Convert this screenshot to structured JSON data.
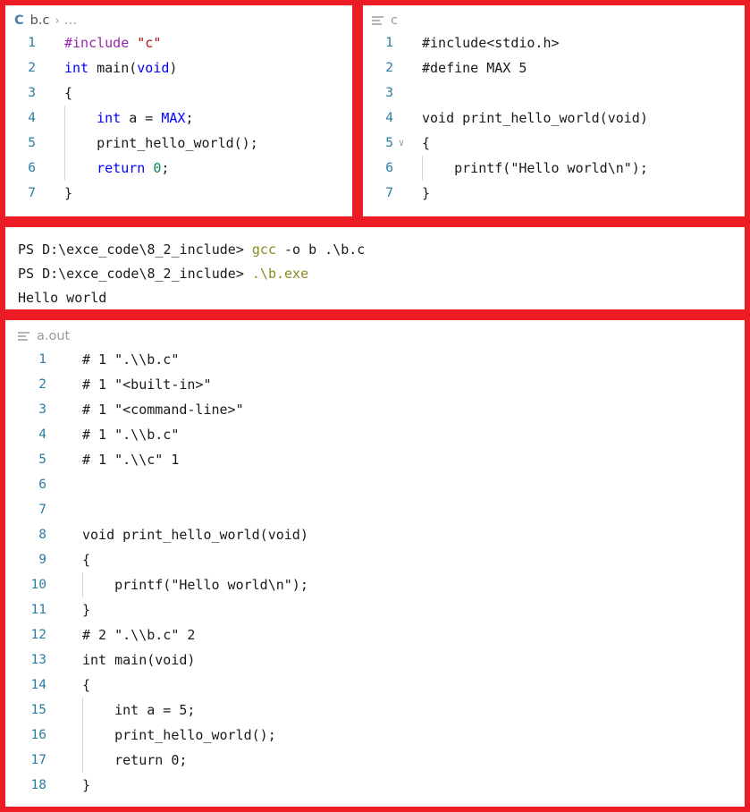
{
  "colors": {
    "annotation_border": "#ed1c24",
    "line_number": "#2c7ba0",
    "keyword": "#0000ff",
    "preprocessor": "#9b24b0",
    "string": "#a31515",
    "number": "#098658",
    "terminal_command": "#8a8a20",
    "background": "#ffffff"
  },
  "editor_bc": {
    "lang_icon": "c-file-icon",
    "lang_letter": "C",
    "file": "b.c",
    "separator": "›",
    "dots": "…"
  },
  "editor_bc_right": {
    "outline_icon": "outline-lines-icon",
    "label": "c"
  },
  "aout_bc": {
    "outline_icon": "outline-lines-icon",
    "label": "a.out"
  },
  "panel_bc": {
    "lines": [
      {
        "n": "1",
        "fold": "",
        "indent": false,
        "tokens": [
          {
            "t": "#include",
            "c": "pre"
          },
          {
            "t": " ",
            "c": "plain"
          },
          {
            "t": "\"c\"",
            "c": "str"
          }
        ]
      },
      {
        "n": "2",
        "fold": "",
        "indent": false,
        "tokens": [
          {
            "t": "int",
            "c": "kw"
          },
          {
            "t": " main(",
            "c": "plain"
          },
          {
            "t": "void",
            "c": "kw"
          },
          {
            "t": ")",
            "c": "plain"
          }
        ]
      },
      {
        "n": "3",
        "fold": "",
        "indent": false,
        "tokens": [
          {
            "t": "{",
            "c": "plain"
          }
        ]
      },
      {
        "n": "4",
        "fold": "",
        "indent": true,
        "tokens": [
          {
            "t": "    ",
            "c": "plain"
          },
          {
            "t": "int",
            "c": "kw"
          },
          {
            "t": " a = ",
            "c": "plain"
          },
          {
            "t": "MAX",
            "c": "macro"
          },
          {
            "t": ";",
            "c": "plain"
          }
        ]
      },
      {
        "n": "5",
        "fold": "",
        "indent": true,
        "tokens": [
          {
            "t": "    print_hello_world();",
            "c": "plain"
          }
        ]
      },
      {
        "n": "6",
        "fold": "",
        "indent": true,
        "tokens": [
          {
            "t": "    ",
            "c": "plain"
          },
          {
            "t": "return",
            "c": "kw"
          },
          {
            "t": " ",
            "c": "plain"
          },
          {
            "t": "0",
            "c": "num"
          },
          {
            "t": ";",
            "c": "plain"
          }
        ]
      },
      {
        "n": "7",
        "fold": "",
        "indent": false,
        "tokens": [
          {
            "t": "}",
            "c": "plain"
          }
        ]
      }
    ]
  },
  "panel_c": {
    "lines": [
      {
        "n": "1",
        "fold": "",
        "indent": false,
        "tokens": [
          {
            "t": "#include<stdio.h>",
            "c": "plain"
          }
        ]
      },
      {
        "n": "2",
        "fold": "",
        "indent": false,
        "tokens": [
          {
            "t": "#define MAX 5",
            "c": "plain"
          }
        ]
      },
      {
        "n": "3",
        "fold": "",
        "indent": false,
        "tokens": [
          {
            "t": "",
            "c": "plain"
          }
        ]
      },
      {
        "n": "4",
        "fold": "",
        "indent": false,
        "tokens": [
          {
            "t": "void print_hello_world(void)",
            "c": "plain"
          }
        ]
      },
      {
        "n": "5",
        "fold": "∨",
        "indent": false,
        "tokens": [
          {
            "t": "{",
            "c": "plain"
          }
        ]
      },
      {
        "n": "6",
        "fold": "",
        "indent": true,
        "tokens": [
          {
            "t": "    printf(\"Hello world\\n\");",
            "c": "plain"
          }
        ]
      },
      {
        "n": "7",
        "fold": "",
        "indent": false,
        "tokens": [
          {
            "t": "}",
            "c": "plain"
          }
        ]
      }
    ]
  },
  "terminal": {
    "lines": [
      {
        "parts": [
          {
            "t": "PS D:\\exce_code\\8_2_include> ",
            "c": "plain"
          },
          {
            "t": "gcc",
            "c": "cmd"
          },
          {
            "t": " -o b .\\b.c",
            "c": "plain"
          }
        ]
      },
      {
        "parts": [
          {
            "t": "PS D:\\exce_code\\8_2_include> ",
            "c": "plain"
          },
          {
            "t": ".\\b.exe",
            "c": "cmd"
          }
        ]
      },
      {
        "parts": [
          {
            "t": "Hello world",
            "c": "plain"
          }
        ]
      }
    ]
  },
  "panel_aout": {
    "lines": [
      {
        "n": "1",
        "fold": "",
        "indent": false,
        "tokens": [
          {
            "t": "# 1 \".\\\\b.c\"",
            "c": "plain"
          }
        ]
      },
      {
        "n": "2",
        "fold": "",
        "indent": false,
        "tokens": [
          {
            "t": "# 1 \"<built-in>\"",
            "c": "plain"
          }
        ]
      },
      {
        "n": "3",
        "fold": "",
        "indent": false,
        "tokens": [
          {
            "t": "# 1 \"<command-line>\"",
            "c": "plain"
          }
        ]
      },
      {
        "n": "4",
        "fold": "",
        "indent": false,
        "tokens": [
          {
            "t": "# 1 \".\\\\b.c\"",
            "c": "plain"
          }
        ]
      },
      {
        "n": "5",
        "fold": "",
        "indent": false,
        "tokens": [
          {
            "t": "# 1 \".\\\\c\" 1",
            "c": "plain"
          }
        ]
      },
      {
        "n": "6",
        "fold": "",
        "indent": false,
        "tokens": [
          {
            "t": "",
            "c": "plain"
          }
        ]
      },
      {
        "n": "7",
        "fold": "",
        "indent": false,
        "tokens": [
          {
            "t": "",
            "c": "plain"
          }
        ]
      },
      {
        "n": "8",
        "fold": "",
        "indent": false,
        "tokens": [
          {
            "t": "void print_hello_world(void)",
            "c": "plain"
          }
        ]
      },
      {
        "n": "9",
        "fold": "",
        "indent": false,
        "tokens": [
          {
            "t": "{",
            "c": "plain"
          }
        ]
      },
      {
        "n": "10",
        "fold": "",
        "indent": true,
        "tokens": [
          {
            "t": "    printf(\"Hello world\\n\");",
            "c": "plain"
          }
        ]
      },
      {
        "n": "11",
        "fold": "",
        "indent": false,
        "tokens": [
          {
            "t": "}",
            "c": "plain"
          }
        ]
      },
      {
        "n": "12",
        "fold": "",
        "indent": false,
        "tokens": [
          {
            "t": "# 2 \".\\\\b.c\" 2",
            "c": "plain"
          }
        ]
      },
      {
        "n": "13",
        "fold": "",
        "indent": false,
        "tokens": [
          {
            "t": "int main(void)",
            "c": "plain"
          }
        ]
      },
      {
        "n": "14",
        "fold": "",
        "indent": false,
        "tokens": [
          {
            "t": "{",
            "c": "plain"
          }
        ]
      },
      {
        "n": "15",
        "fold": "",
        "indent": true,
        "tokens": [
          {
            "t": "    int a = 5;",
            "c": "plain"
          }
        ]
      },
      {
        "n": "16",
        "fold": "",
        "indent": true,
        "tokens": [
          {
            "t": "    print_hello_world();",
            "c": "plain"
          }
        ]
      },
      {
        "n": "17",
        "fold": "",
        "indent": true,
        "tokens": [
          {
            "t": "    return 0;",
            "c": "plain"
          }
        ]
      },
      {
        "n": "18",
        "fold": "",
        "indent": false,
        "tokens": [
          {
            "t": "}",
            "c": "plain"
          }
        ]
      }
    ]
  }
}
